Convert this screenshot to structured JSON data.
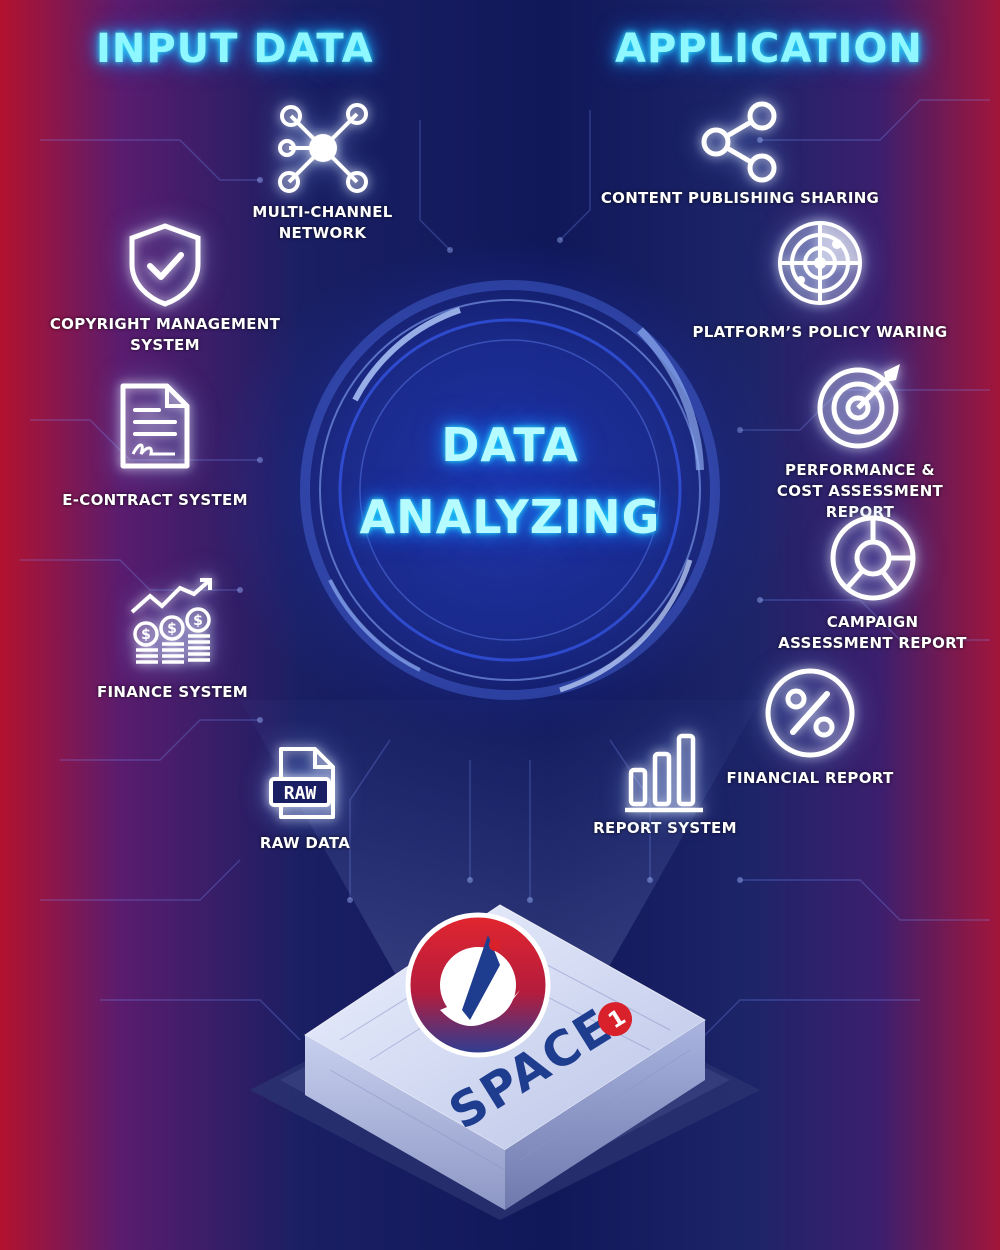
{
  "headings": {
    "input": "INPUT DATA",
    "application": "APPLICATION"
  },
  "core": {
    "line1": "DATA",
    "line2": "ANALYZING"
  },
  "input_nodes": [
    {
      "label": "MULTI-CHANNEL\nNETWORK",
      "icon": "network-nodes-icon"
    },
    {
      "label": "COPYRIGHT MANAGEMENT\nSYSTEM",
      "icon": "shield-check-icon"
    },
    {
      "label": "E-CONTRACT SYSTEM",
      "icon": "document-signature-icon"
    },
    {
      "label": "FINANCE SYSTEM",
      "icon": "growth-coins-icon"
    },
    {
      "label": "RAW DATA",
      "icon": "raw-file-icon"
    }
  ],
  "application_nodes": [
    {
      "label": "CONTENT PUBLISHING SHARING",
      "icon": "share-icon"
    },
    {
      "label": "PLATFORM’S POLICY WARING",
      "icon": "radar-icon"
    },
    {
      "label": "PERFORMANCE &\nCOST ASSESSMENT REPORT",
      "icon": "target-icon"
    },
    {
      "label": "CAMPAIGN\nASSESSMENT REPORT",
      "icon": "donut-chart-icon"
    },
    {
      "label": "FINANCIAL REPORT",
      "icon": "percent-icon"
    },
    {
      "label": "REPORT SYSTEM",
      "icon": "bar-chart-icon"
    }
  ],
  "logo": {
    "text": "SPACE",
    "badge": "1"
  },
  "colors": {
    "accent_glow": "#8ff7ff",
    "left_edge": "#b3122e",
    "right_edge": "#a2153a",
    "logo_red": "#d9212b",
    "logo_blue": "#1f3d8f"
  }
}
